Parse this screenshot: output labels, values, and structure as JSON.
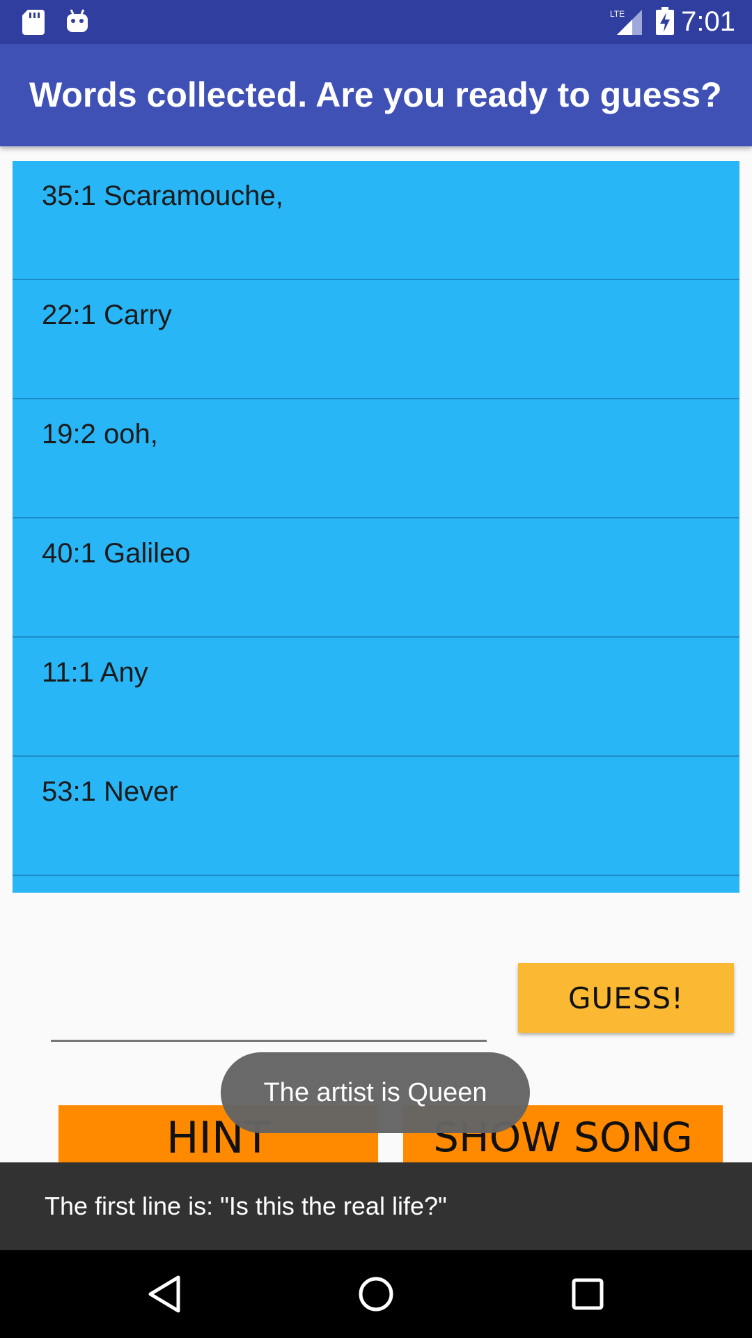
{
  "status_bar": {
    "time": "7:01",
    "network": "LTE",
    "icons": [
      "sd-card-icon",
      "android-icon",
      "signal-icon",
      "battery-charging-icon"
    ]
  },
  "app_bar": {
    "title": "Words collected. Are you ready to guess?"
  },
  "words": [
    {
      "text": "35:1 Scaramouche,"
    },
    {
      "text": "22:1 Carry"
    },
    {
      "text": "19:2 ooh,"
    },
    {
      "text": "40:1 Galileo"
    },
    {
      "text": "11:1 Any"
    },
    {
      "text": "53:1 Never"
    }
  ],
  "guess": {
    "input_value": "",
    "button_label": "GUESS!"
  },
  "actions": {
    "hint_label": "HINT",
    "show_song_label": "SHOW SONG"
  },
  "toast": {
    "text": "The artist is Queen"
  },
  "snackbar": {
    "text": "The first line is: \"Is this the real life?\""
  },
  "colors": {
    "status_bar": "#303f9f",
    "app_bar": "#3f51b5",
    "list_background": "#29b6f6",
    "guess_button": "#fbb933",
    "action_buttons": "#ff8a00",
    "snackbar": "#323232"
  }
}
